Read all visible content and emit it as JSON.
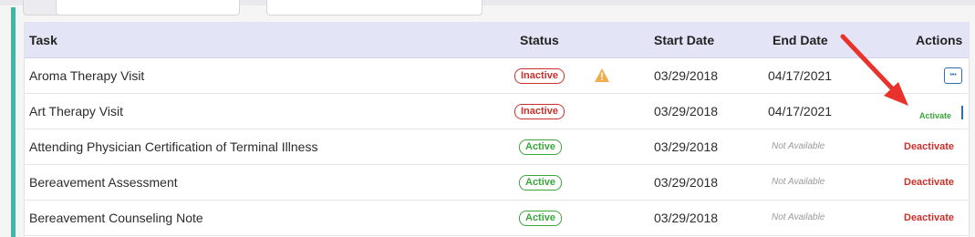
{
  "table": {
    "headers": {
      "task": "Task",
      "status": "Status",
      "start_date": "Start Date",
      "end_date": "End Date",
      "actions": "Actions"
    },
    "rows": [
      {
        "task": "Aroma Therapy Visit",
        "status": "Inactive",
        "warning": true,
        "start_date": "03/29/2018",
        "end_date": "04/17/2021",
        "action": "more-menu",
        "action_label": "•••"
      },
      {
        "task": "Art Therapy Visit",
        "status": "Inactive",
        "warning": false,
        "start_date": "03/29/2018",
        "end_date": "04/17/2021",
        "action": "Activate"
      },
      {
        "task": "Attending Physician Certification of Terminal Illness",
        "status": "Active",
        "warning": false,
        "start_date": "03/29/2018",
        "end_date": "Not Available",
        "action": "Deactivate"
      },
      {
        "task": "Bereavement Assessment",
        "status": "Active",
        "warning": false,
        "start_date": "03/29/2018",
        "end_date": "Not Available",
        "action": "Deactivate"
      },
      {
        "task": "Bereavement Counseling Note",
        "status": "Active",
        "warning": false,
        "start_date": "03/29/2018",
        "end_date": "Not Available",
        "action": "Deactivate"
      }
    ]
  },
  "colors": {
    "accent_teal": "#3fb6a8",
    "header_bg": "#e4e4f7",
    "inactive_red": "#c9302c",
    "active_green": "#3aa53a",
    "link_blue": "#2d6db3",
    "warning_orange": "#f0ad4e",
    "annotation_arrow": "#e8322b"
  },
  "icons": {
    "warning": "warning-triangle-icon",
    "more": "ellipsis-icon",
    "annotation": "red-arrow-annotation"
  }
}
